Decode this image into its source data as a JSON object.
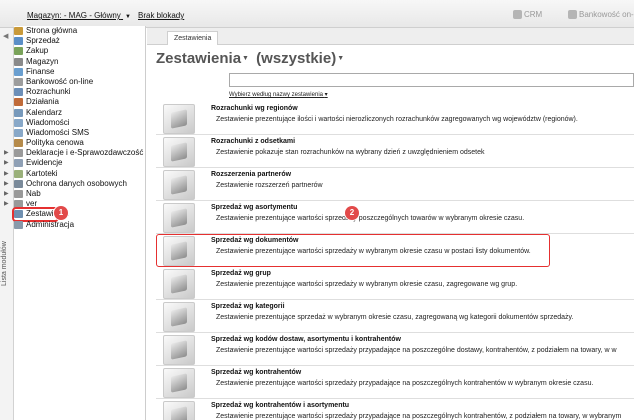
{
  "topbar": {
    "warehouse": "Magazyn: - MAG - Główny",
    "missing": "Brak blokady",
    "crm": "CRM",
    "bank": "Bankowość on-"
  },
  "rail": {
    "label": "Lista modułów"
  },
  "sidebar": {
    "items": [
      {
        "label": "Strona główna",
        "icon": "home-icon",
        "color": "#c99a3a"
      },
      {
        "label": "Sprzedaż",
        "icon": "sales-icon",
        "color": "#5b8fc7"
      },
      {
        "label": "Zakup",
        "icon": "purchase-icon",
        "color": "#7aa35a"
      },
      {
        "label": "Magazyn",
        "icon": "warehouse-icon",
        "color": "#8a8a8a"
      },
      {
        "label": "Finanse",
        "icon": "finance-icon",
        "color": "#6a9fd0"
      },
      {
        "label": "Bankowość on-line",
        "icon": "bank-icon",
        "color": "#9d9d9d"
      },
      {
        "label": "Rozrachunki",
        "icon": "settlements-icon",
        "color": "#6c8fb8"
      },
      {
        "label": "Działania",
        "icon": "actions-icon",
        "color": "#c06b3a"
      },
      {
        "label": "Kalendarz",
        "icon": "calendar-icon",
        "color": "#7799bb"
      },
      {
        "label": "Wiadomości",
        "icon": "messages-icon",
        "color": "#88a8c8"
      },
      {
        "label": "Wiadomości SMS",
        "icon": "sms-icon",
        "color": "#88a8c8"
      },
      {
        "label": "Polityka cenowa",
        "icon": "pricing-icon",
        "color": "#b58a4a"
      },
      {
        "label": "Deklaracje i e-Sprawozdawczość",
        "icon": "declarations-icon",
        "color": "#9a9a9a"
      },
      {
        "label": "Ewidencje",
        "icon": "records-icon",
        "color": "#8fa0b5"
      },
      {
        "label": "Kartoteki",
        "icon": "index-icon",
        "color": "#9ab07a"
      },
      {
        "label": "Ochrona danych osobowych",
        "icon": "privacy-icon",
        "color": "#7a8a9a"
      },
      {
        "label": "Nab",
        "icon": "dial-icon",
        "color": "#999999"
      },
      {
        "label": "ver",
        "icon": "version-icon",
        "color": "#999999"
      },
      {
        "label": "Zestawienia",
        "icon": "reports-icon",
        "color": "#6f8fb0"
      },
      {
        "label": "Administracja",
        "icon": "admin-icon",
        "color": "#8899aa"
      }
    ]
  },
  "main": {
    "tab": "Zestawienia",
    "heading_part1": "Zestawienia",
    "heading_part2": "(wszystkie)",
    "search_hint": "Wybierz według nazwy zestawienia",
    "rows": [
      {
        "title": "Rozrachunki wg regionów",
        "desc": "Zestawienie prezentujące ilości i wartości nierozliczonych rozrachunków zagregowanych wg województw (regionów)."
      },
      {
        "title": "Rozrachunki z odsetkami",
        "desc": "Zestawienie pokazuje stan rozrachunków na wybrany dzień z uwzględnieniem odsetek"
      },
      {
        "title": "Rozszerzenia partnerów",
        "desc": "Zestawienie rozszerzeń partnerów"
      },
      {
        "title": "Sprzedaż wg asortymentu",
        "desc": "Zestawienie prezentujące wartości sprzedaży poszczególnych towarów w wybranym okresie czasu."
      },
      {
        "title": "Sprzedaż wg dokumentów",
        "desc": "Zestawienie prezentujące wartości sprzedaży w wybranym okresie czasu w postaci listy dokumentów."
      },
      {
        "title": "Sprzedaż wg grup",
        "desc": "Zestawienie prezentujące wartości sprzedaży w wybranym okresie czasu, zagregowane wg grup."
      },
      {
        "title": "Sprzedaż wg kategorii",
        "desc": "Zestawienie prezentujące sprzedaż w wybranym okresie czasu, zagregowaną wg kategorii dokumentów sprzedaży."
      },
      {
        "title": "Sprzedaż wg kodów dostaw, asortymentu i kontrahentów",
        "desc": "Zestawienie prezentujące wartości sprzedaży przypadające na poszczególne dostawy, kontrahentów, z podziałem na towary, w w"
      },
      {
        "title": "Sprzedaż wg kontrahentów",
        "desc": "Zestawienie prezentujące wartości sprzedaży przypadające na poszczególnych kontrahentów w wybranym okresie czasu."
      },
      {
        "title": "Sprzedaż wg kontrahentów i asortymentu",
        "desc": "Zestawienie prezentujące wartości sprzedaży przypadające na poszczególnych kontrahentów, z podziałem na towary, w wybranym"
      }
    ]
  },
  "callouts": {
    "one": "1",
    "two": "2"
  },
  "colors": {
    "highlight": "#e53030",
    "badge": "#e24a4a"
  }
}
